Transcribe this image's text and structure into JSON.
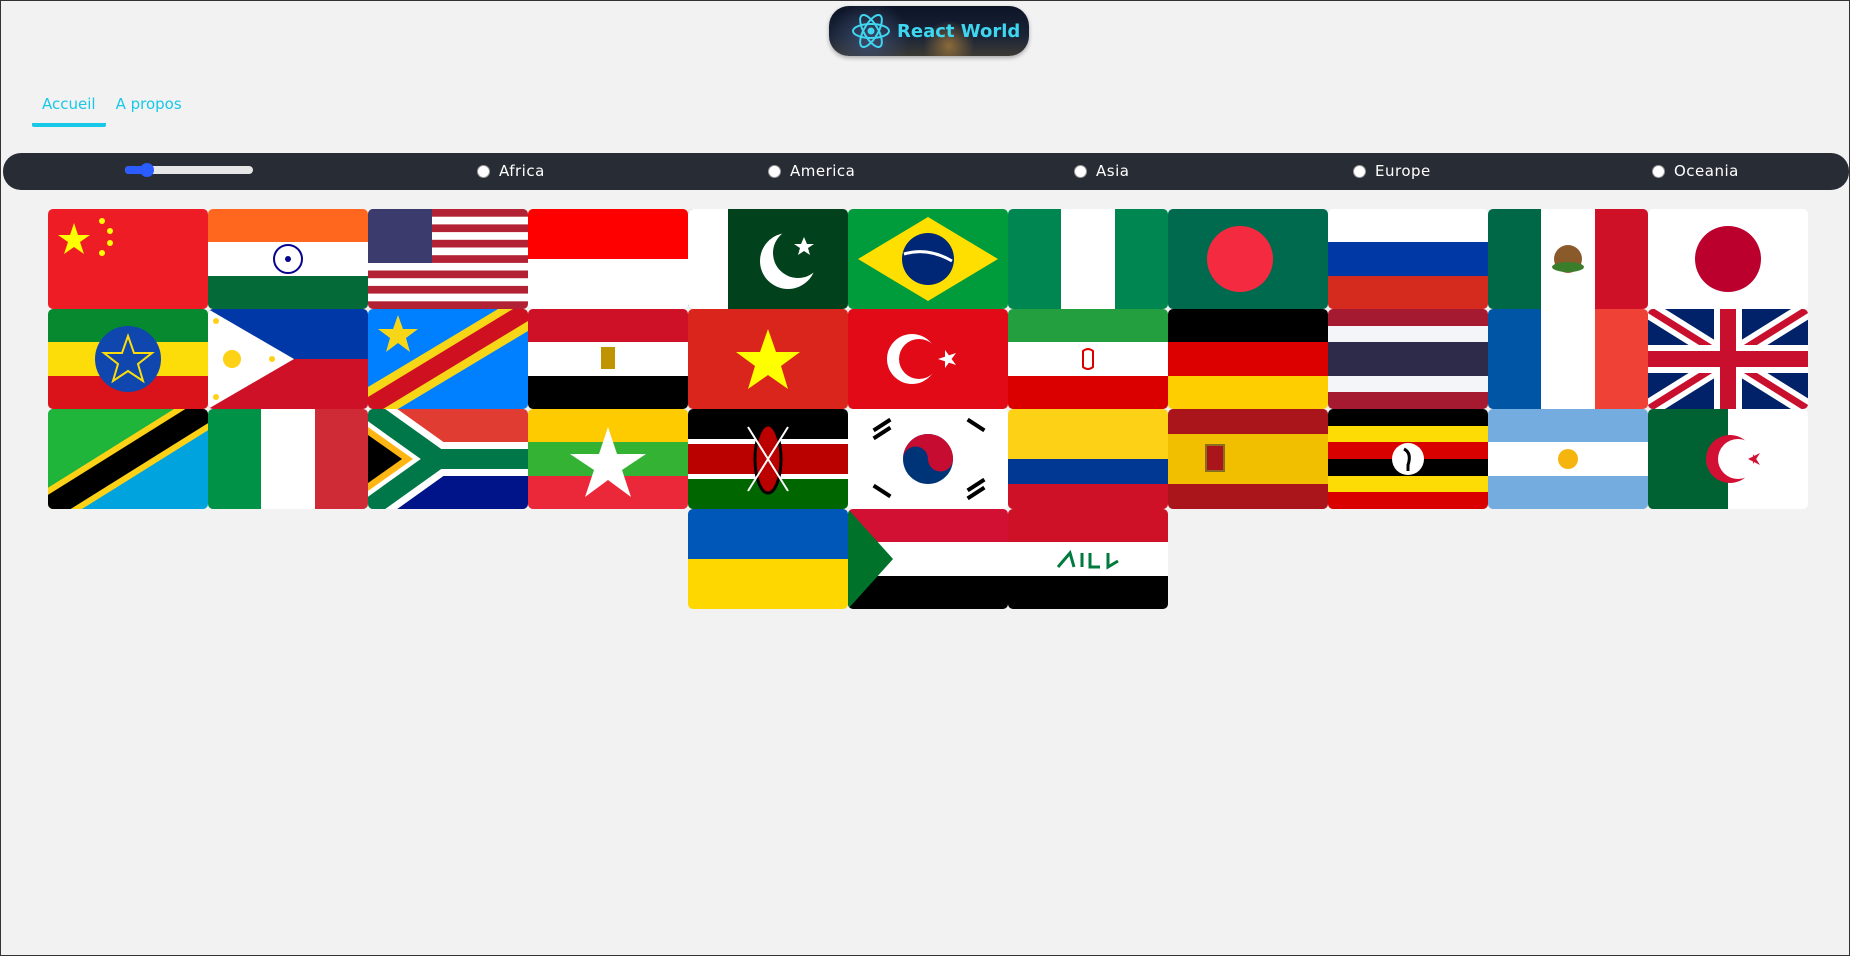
{
  "logo": {
    "text": "React World",
    "color": "#3fd6f0"
  },
  "nav": {
    "items": [
      {
        "label": "Accueil",
        "active": true
      },
      {
        "label": "A propos",
        "active": false
      }
    ]
  },
  "filters": {
    "range_value": 0.15,
    "regions": [
      "Africa",
      "America",
      "Asia",
      "Europe",
      "Oceania"
    ]
  },
  "flags": [
    {
      "name": "china-flag"
    },
    {
      "name": "india-flag"
    },
    {
      "name": "usa-flag"
    },
    {
      "name": "indonesia-flag"
    },
    {
      "name": "pakistan-flag"
    },
    {
      "name": "brazil-flag"
    },
    {
      "name": "nigeria-flag"
    },
    {
      "name": "bangladesh-flag"
    },
    {
      "name": "russia-flag"
    },
    {
      "name": "mexico-flag"
    },
    {
      "name": "japan-flag"
    },
    {
      "name": "ethiopia-flag"
    },
    {
      "name": "philippines-flag"
    },
    {
      "name": "dr-congo-flag"
    },
    {
      "name": "egypt-flag"
    },
    {
      "name": "vietnam-flag"
    },
    {
      "name": "turkey-flag"
    },
    {
      "name": "iran-flag"
    },
    {
      "name": "germany-flag"
    },
    {
      "name": "thailand-flag"
    },
    {
      "name": "france-flag"
    },
    {
      "name": "uk-flag"
    },
    {
      "name": "tanzania-flag"
    },
    {
      "name": "italy-flag"
    },
    {
      "name": "south-africa-flag"
    },
    {
      "name": "myanmar-flag"
    },
    {
      "name": "kenya-flag"
    },
    {
      "name": "south-korea-flag"
    },
    {
      "name": "colombia-flag"
    },
    {
      "name": "spain-flag"
    },
    {
      "name": "uganda-flag"
    },
    {
      "name": "argentina-flag"
    },
    {
      "name": "algeria-flag"
    },
    {
      "name": "ukraine-flag"
    },
    {
      "name": "sudan-flag"
    },
    {
      "name": "iraq-flag"
    }
  ]
}
